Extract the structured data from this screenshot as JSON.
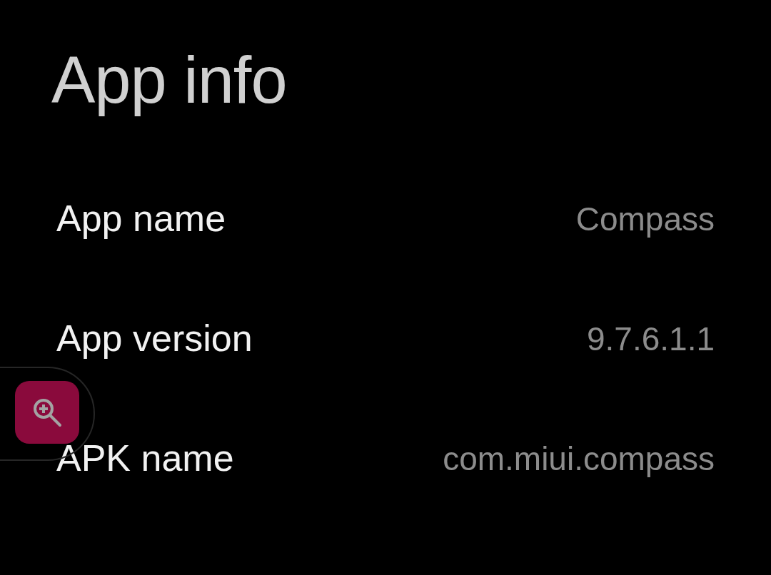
{
  "title": "App info",
  "rows": [
    {
      "label": "App name",
      "value": "Compass"
    },
    {
      "label": "App version",
      "value": "9.7.6.1.1"
    },
    {
      "label": "APK name",
      "value": "com.miui.compass"
    }
  ]
}
